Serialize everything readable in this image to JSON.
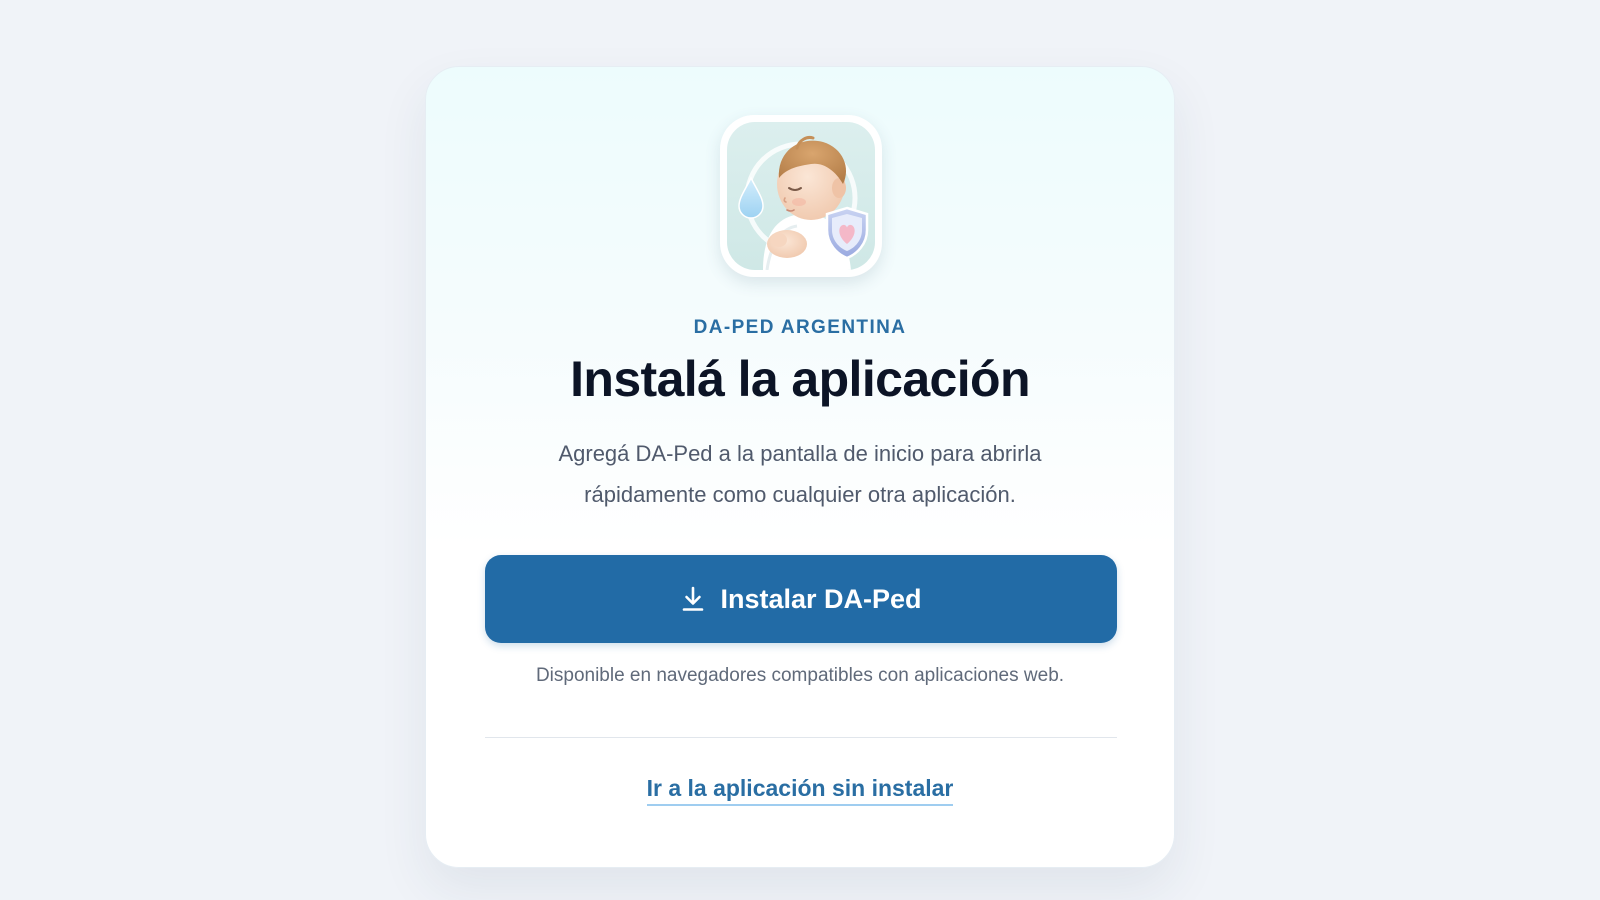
{
  "app": {
    "eyebrow": "DA-PED ARGENTINA",
    "icon": "baby-with-shield-and-drop-icon"
  },
  "title": "Instalá la aplicación",
  "description": "Agregá DA-Ped a la pantalla de inicio para abrirla rápidamente como cualquier otra aplicación.",
  "install_button": {
    "label": "Instalar DA-Ped",
    "icon": "download-icon",
    "color": "#226ba6"
  },
  "availability_note": "Disponible en navegadores compatibles con aplicaciones web.",
  "skip_link": {
    "label": "Ir a la aplicación sin instalar"
  },
  "colors": {
    "accent": "#226ba6",
    "link": "#2a6ea3",
    "title": "#0c1426",
    "background": "#f0f3f8"
  }
}
